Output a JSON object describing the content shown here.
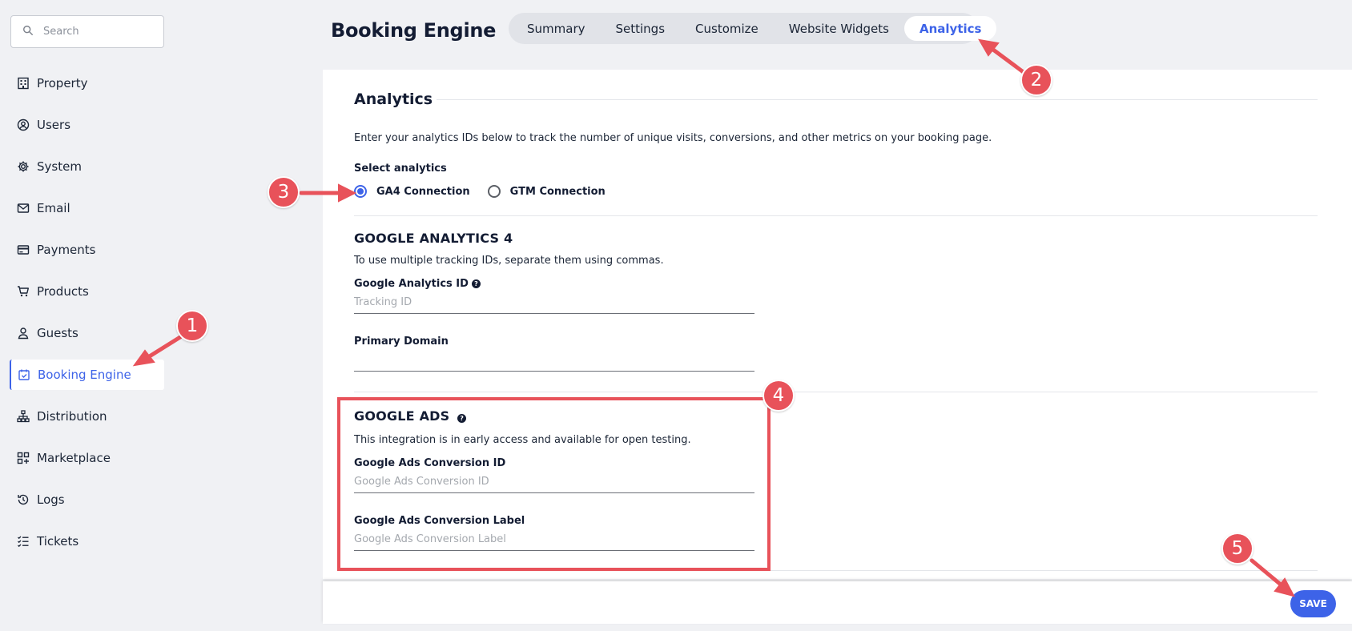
{
  "sidebar": {
    "search_placeholder": "Search",
    "items": [
      {
        "label": "Property",
        "icon": "building-icon"
      },
      {
        "label": "Users",
        "icon": "user-circle-icon"
      },
      {
        "label": "System",
        "icon": "gear-icon"
      },
      {
        "label": "Email",
        "icon": "envelope-icon"
      },
      {
        "label": "Payments",
        "icon": "credit-card-icon"
      },
      {
        "label": "Products",
        "icon": "cart-icon"
      },
      {
        "label": "Guests",
        "icon": "person-icon"
      },
      {
        "label": "Booking Engine",
        "icon": "calendar-check-icon"
      },
      {
        "label": "Distribution",
        "icon": "sitemap-icon"
      },
      {
        "label": "Marketplace",
        "icon": "grid-plus-icon"
      },
      {
        "label": "Logs",
        "icon": "history-icon"
      },
      {
        "label": "Tickets",
        "icon": "checklist-icon"
      }
    ],
    "active_item": "Booking Engine"
  },
  "header": {
    "title": "Booking Engine",
    "tabs": [
      "Summary",
      "Settings",
      "Customize",
      "Website Widgets",
      "Analytics"
    ],
    "active_tab": "Analytics"
  },
  "analytics": {
    "title": "Analytics",
    "intro": "Enter your analytics IDs below to track the number of unique visits, conversions, and other metrics on your booking page.",
    "select_label": "Select analytics",
    "options": [
      "GA4 Connection",
      "GTM Connection"
    ],
    "selected_option": "GA4 Connection"
  },
  "ga4": {
    "title": "GOOGLE ANALYTICS 4",
    "helper": "To use multiple tracking IDs, separate them using commas.",
    "id_label": "Google Analytics ID",
    "id_placeholder": "Tracking ID",
    "id_value": "",
    "domain_label": "Primary Domain",
    "domain_value": ""
  },
  "google_ads": {
    "title": "GOOGLE ADS",
    "helper": "This integration is in early access and available for open testing.",
    "conversion_id_label": "Google Ads Conversion ID",
    "conversion_id_placeholder": "Google Ads Conversion ID",
    "conversion_label_label": "Google Ads Conversion Label",
    "conversion_label_placeholder": "Google Ads Conversion Label"
  },
  "footer": {
    "save_label": "SAVE"
  },
  "annotations": [
    "1",
    "2",
    "3",
    "4",
    "5"
  ],
  "colors": {
    "accent": "#3d63e8",
    "annotation": "#e8525a",
    "background": "#f0f1f4",
    "text": "#131c33"
  }
}
